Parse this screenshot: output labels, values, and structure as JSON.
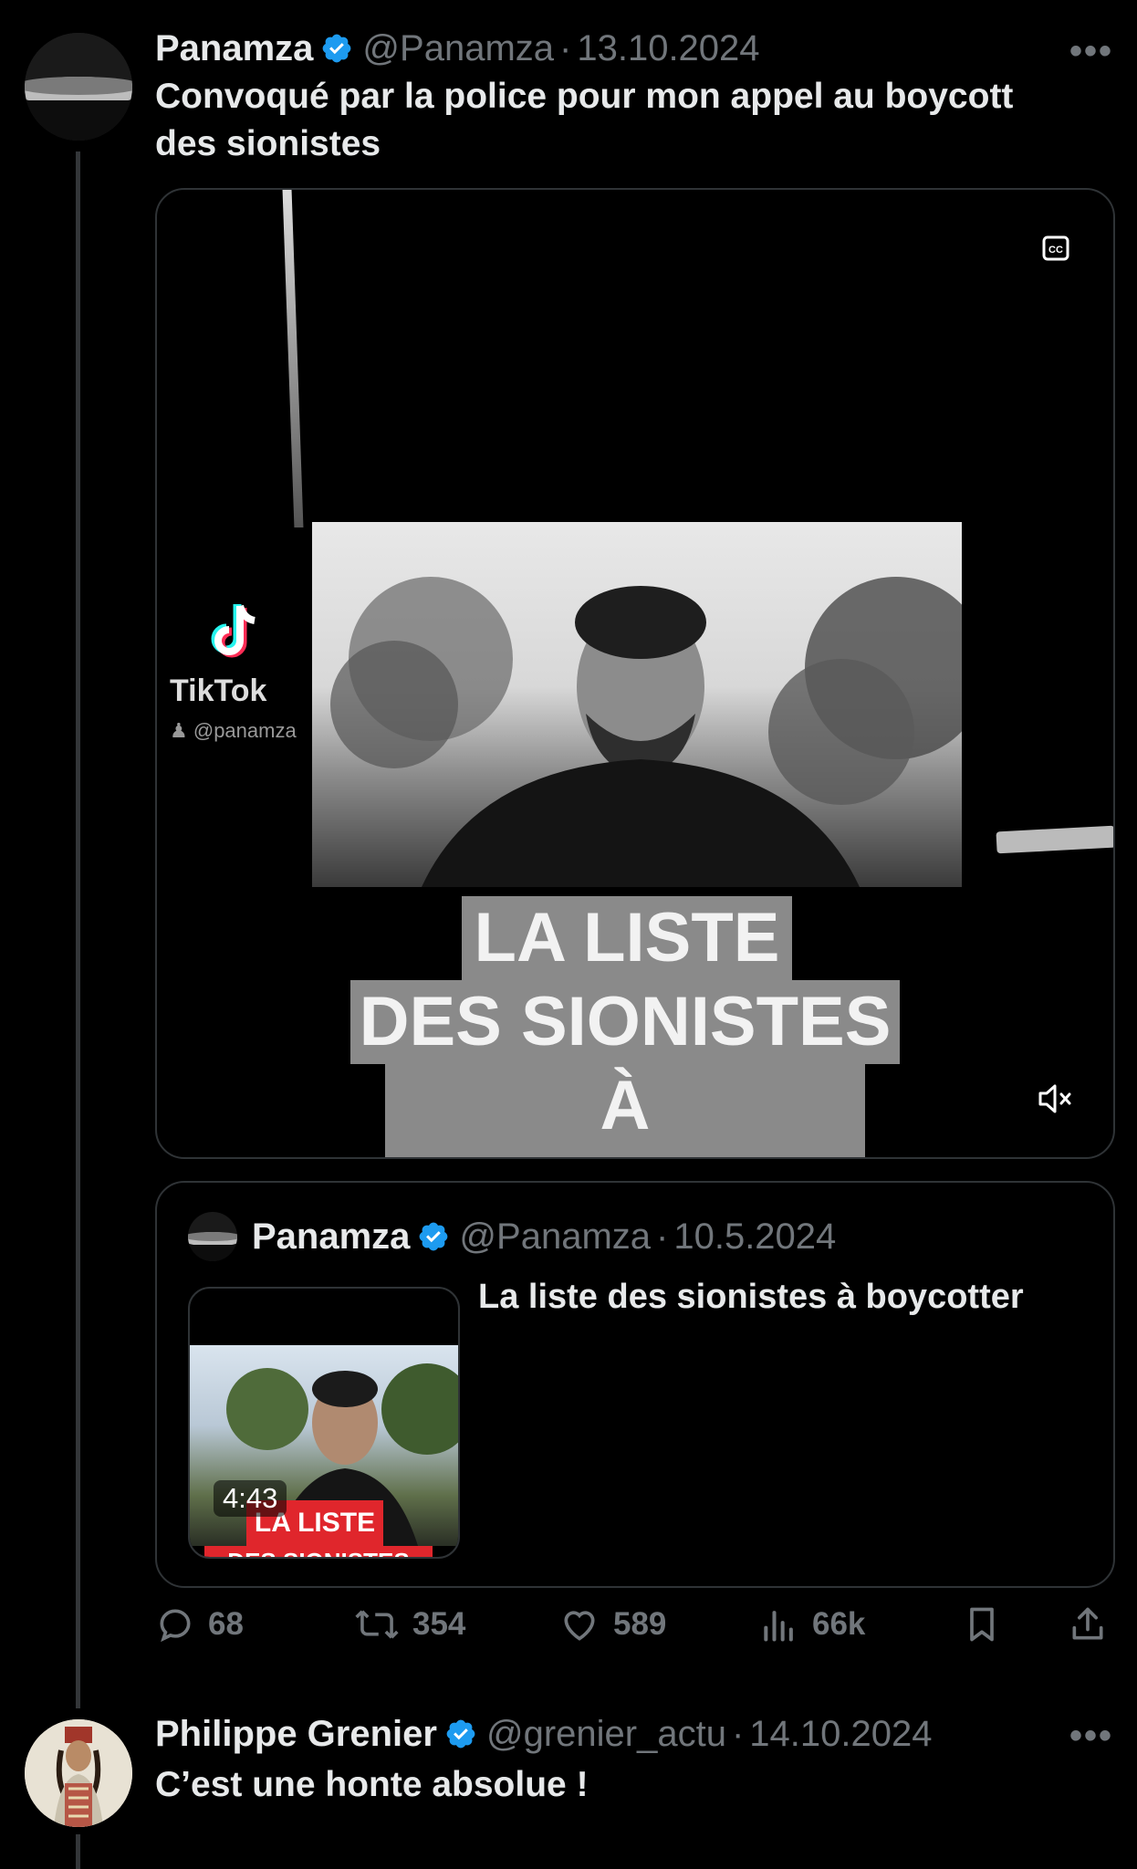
{
  "tweet1": {
    "name": "Panamza",
    "handle": "@Panamza",
    "date": "13.10.2024",
    "separator": "·",
    "more": "•••",
    "text": "Convoqué par la police pour mon appel au boycott des sionistes"
  },
  "video": {
    "platform": "TikTok",
    "user": "@panamza",
    "overlay_lines": [
      "LA LISTE",
      "DES SIONISTES",
      "À BOYCOTTER"
    ],
    "icons": [
      "closed-captions-icon",
      "muted-speaker-icon"
    ]
  },
  "quote": {
    "name": "Panamza",
    "handle": "@Panamza",
    "date": "10.5.2024",
    "separator": "·",
    "text": "La liste des sionistes à boycotter",
    "duration": "4:43",
    "thumb_caption_1": "LA LISTE",
    "thumb_caption_2": "DES SIONISTES"
  },
  "actions": {
    "replies": "68",
    "reposts": "354",
    "likes": "589",
    "views": "66k"
  },
  "tweet2": {
    "name": "Philippe Grenier",
    "handle": "@grenier_actu",
    "date": "14.10.2024",
    "separator": "·",
    "more": "•••",
    "text": "C’est une honte absolue !"
  },
  "colors": {
    "background": "#000000",
    "text": "#e7e9ea",
    "muted": "#71767b",
    "verified": "#1d9bf0",
    "border": "#2f3336"
  }
}
